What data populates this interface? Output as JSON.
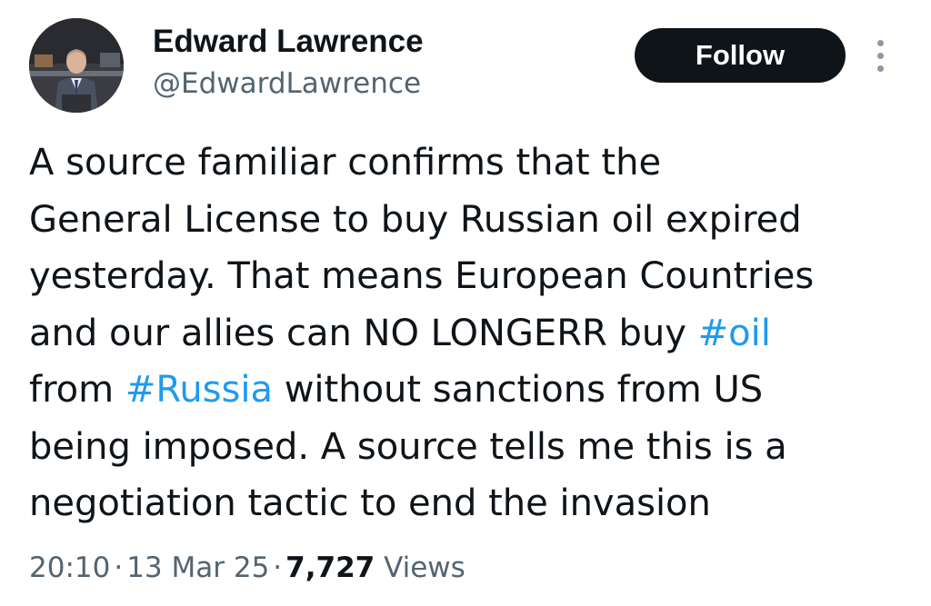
{
  "author": {
    "display_name": "Edward Lawrence",
    "handle": "@EdwardLawrence"
  },
  "follow_button": {
    "label": "Follow"
  },
  "tweet": {
    "lines": [
      [
        {
          "text": "A source familiar confirms that the"
        }
      ],
      [
        {
          "text": "General License to buy Russian oil expired"
        }
      ],
      [
        {
          "text": "yesterday. That means European Countries"
        }
      ],
      [
        {
          "text": "and our allies can NO LONGERR buy "
        },
        {
          "text": "#oil",
          "hashtag": true
        }
      ],
      [
        {
          "text": "from "
        },
        {
          "text": "#Russia",
          "hashtag": true
        },
        {
          "text": " without sanctions from US"
        }
      ],
      [
        {
          "text": "being imposed. A source tells me this is a"
        }
      ],
      [
        {
          "text": "negotiation tactic to end the invasion"
        }
      ]
    ]
  },
  "meta": {
    "time": "20:10",
    "separator": "·",
    "date": "13 Mar 25",
    "views_count": "7,727",
    "views_label": "Views"
  },
  "icons": {
    "more": "more-vertical-icon"
  },
  "colors": {
    "hashtag": "#1d9bf0",
    "follow_bg": "#0f1419",
    "secondary_text": "#536471"
  }
}
